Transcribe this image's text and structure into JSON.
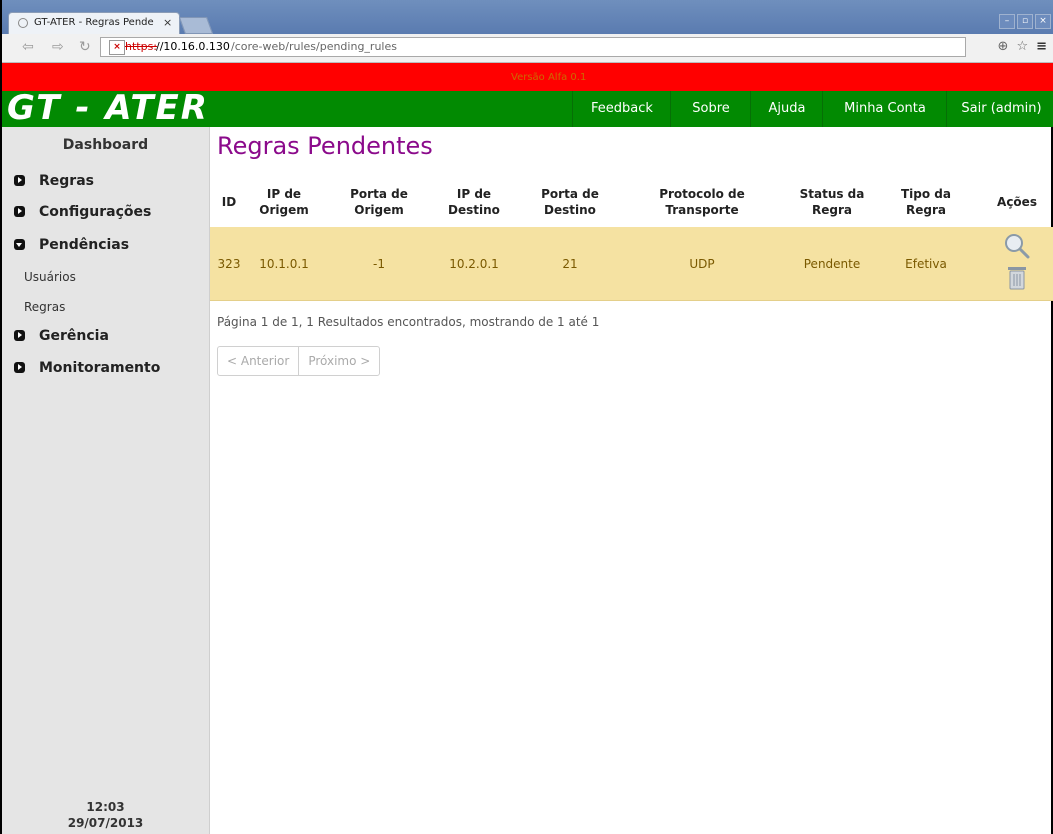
{
  "browser": {
    "tab_title": "GT-ATER - Regras Pender",
    "tab_close": "×",
    "url_scheme": "https:",
    "url_host": "//10.16.0.130",
    "url_path": "/core-web/rules/pending_rules",
    "back_glyph": "⇦",
    "forward_glyph": "⇨",
    "reload_glyph": "↻",
    "zoom_glyph": "⊕",
    "star_glyph": "☆",
    "menu_glyph": "≡",
    "win_min": "–",
    "win_max": "▫",
    "win_close": "×"
  },
  "app": {
    "version_text": "Versão Alfa 0.1",
    "logo": "GT - ATER",
    "nav": [
      "Feedback",
      "Sobre",
      "Ajuda",
      "Minha Conta",
      "Sair (admin)"
    ]
  },
  "sidebar": {
    "dashboard": "Dashboard",
    "items": {
      "regras": "Regras",
      "configuracoes": "Configurações",
      "pendencias": "Pendências",
      "sub_usuarios": "Usuários",
      "sub_regras": "Regras",
      "gerencia": "Gerência",
      "monitoramento": "Monitoramento"
    },
    "time": "12:03",
    "date": "29/07/2013"
  },
  "main": {
    "title": "Regras Pendentes",
    "columns": {
      "id": "ID",
      "ip_origem": [
        "IP de",
        "Origem"
      ],
      "porta_origem": [
        "Porta de",
        "Origem"
      ],
      "ip_destino": [
        "IP de",
        "Destino"
      ],
      "porta_destino": [
        "Porta de",
        "Destino"
      ],
      "protocolo": [
        "Protocolo de",
        "Transporte"
      ],
      "status": [
        "Status da",
        "Regra"
      ],
      "tipo": [
        "Tipo da",
        "Regra"
      ],
      "acoes": "Ações"
    },
    "rows": [
      {
        "id": "323",
        "ip_origem": "10.1.0.1",
        "porta_origem": "-1",
        "ip_destino": "10.2.0.1",
        "porta_destino": "21",
        "protocolo": "UDP",
        "status": "Pendente",
        "tipo": "Efetiva",
        "actions": [
          "search-icon",
          "trash-icon"
        ]
      }
    ],
    "pagination_info": "Página 1 de 1, 1 Resultados encontrados, mostrando de 1 até 1",
    "prev_label": "< Anterior",
    "next_label": "Próximo >"
  },
  "colors": {
    "version_bar": "#ff0000",
    "header": "#028a02",
    "title": "#8b0a8b",
    "row_bg": "#f5e2a2"
  }
}
